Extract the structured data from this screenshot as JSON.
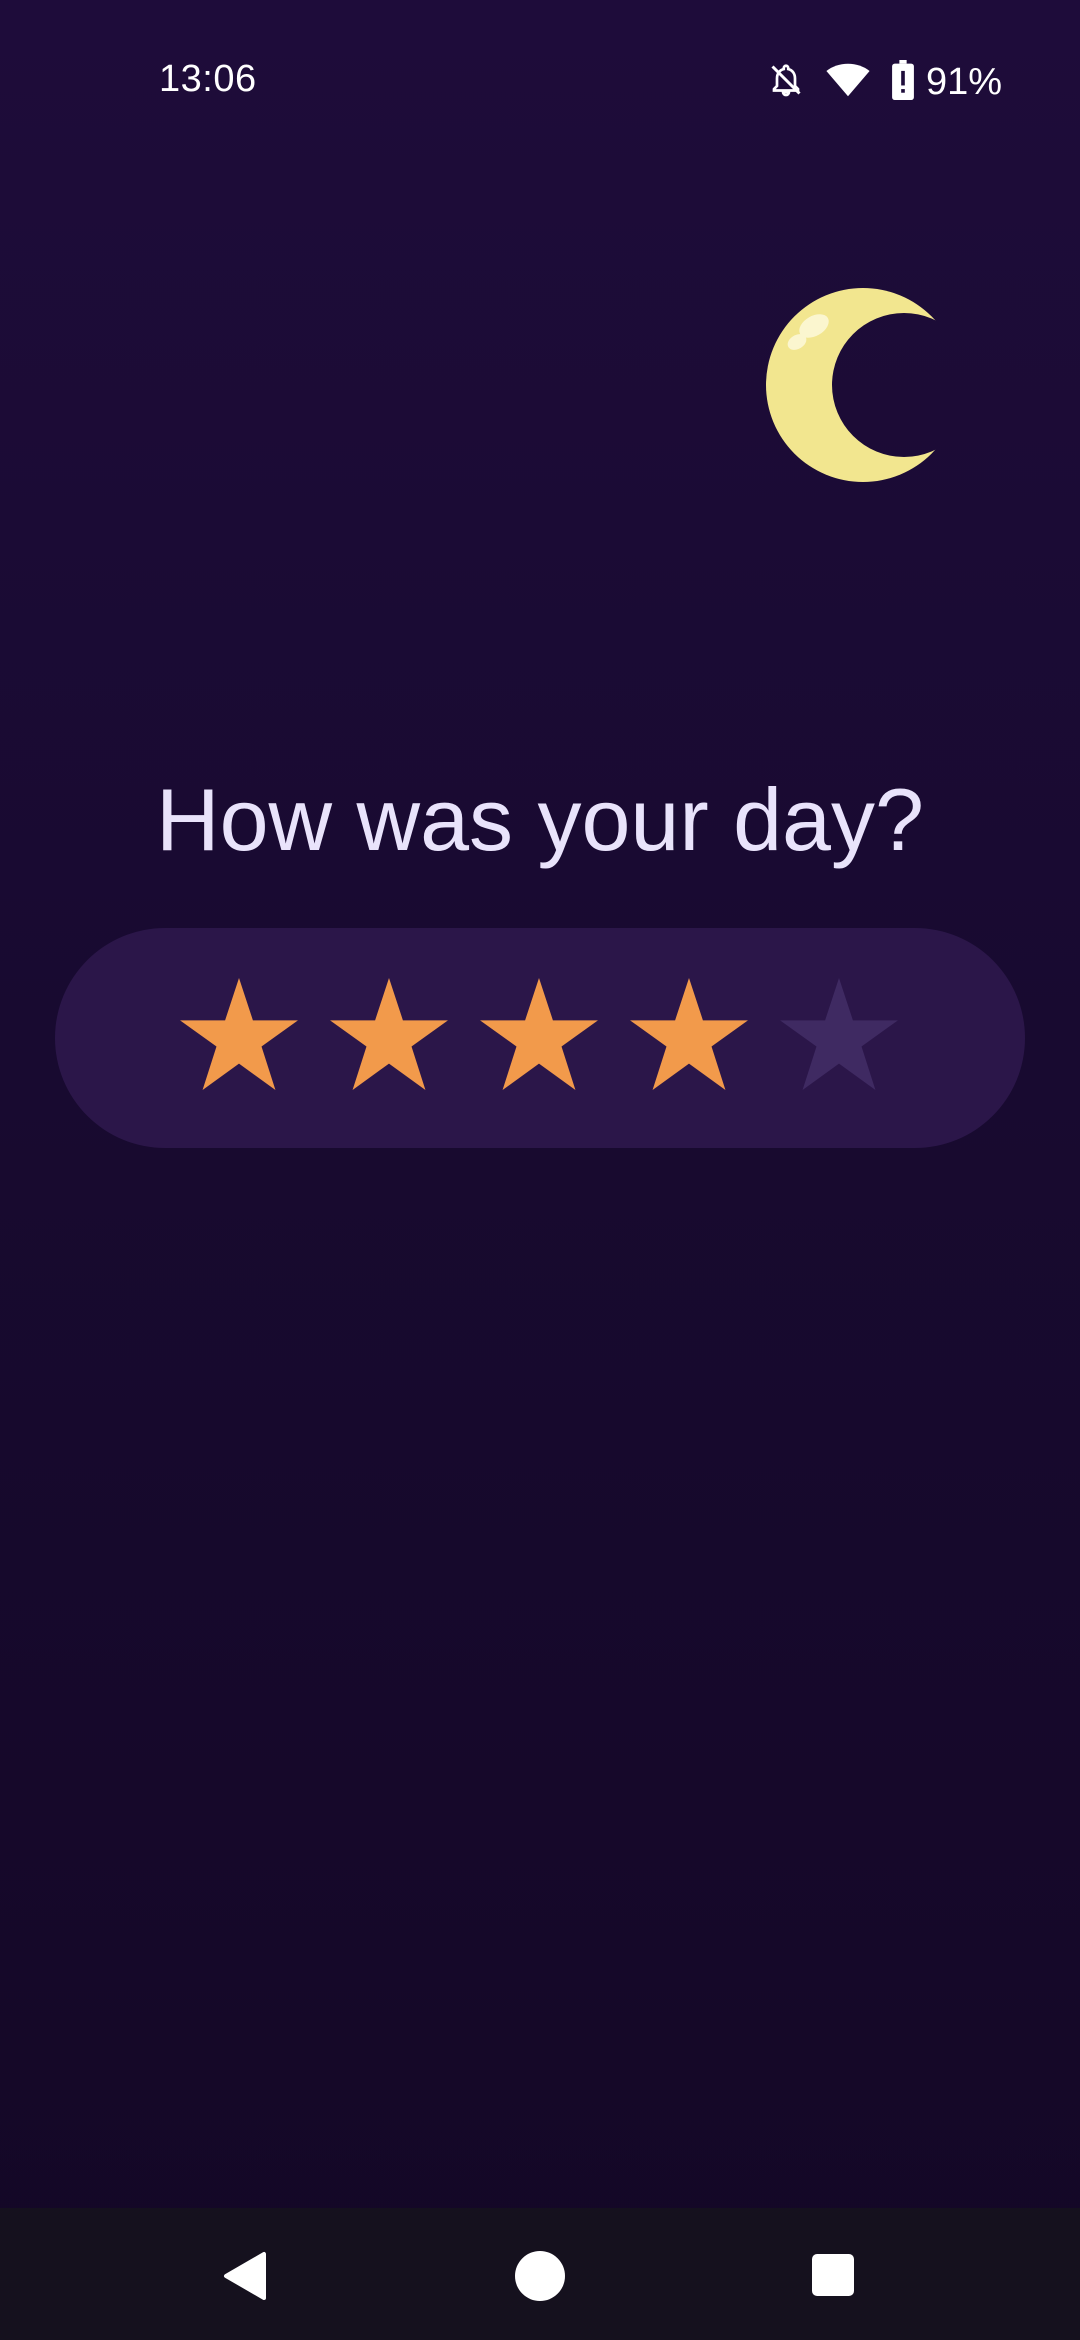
{
  "status_bar": {
    "time": "13:06",
    "battery_percent": "91%",
    "icons": [
      "alarm-off-icon",
      "wifi-icon",
      "battery-icon"
    ]
  },
  "illustration": {
    "icon": "moon-icon",
    "color": "#f2e68f"
  },
  "prompt": {
    "question": "How was your day?"
  },
  "rating": {
    "value": 4,
    "max": 5,
    "filled_color": "#f29a4b",
    "empty_color": "#3f2a62",
    "card_color": "#2b1649"
  },
  "navigation": {
    "buttons": [
      "back-icon",
      "home-icon",
      "recents-icon"
    ]
  }
}
